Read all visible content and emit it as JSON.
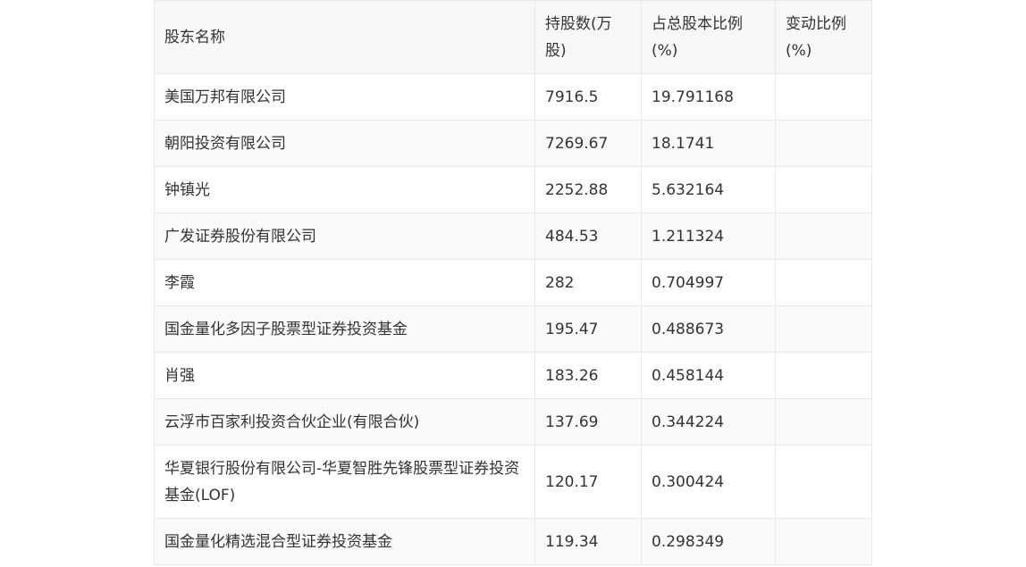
{
  "table": {
    "headers": [
      "股东名称",
      "持股数(万股)",
      "占总股本比例(%)",
      "变动比例(%)"
    ],
    "rows": [
      [
        "美国万邦有限公司",
        "7916.5",
        "19.791168",
        ""
      ],
      [
        "朝阳投资有限公司",
        "7269.67",
        "18.1741",
        ""
      ],
      [
        "钟镇光",
        "2252.88",
        "5.632164",
        ""
      ],
      [
        "广发证券股份有限公司",
        "484.53",
        "1.211324",
        ""
      ],
      [
        "李霞",
        "282",
        "0.704997",
        ""
      ],
      [
        "国金量化多因子股票型证券投资基金",
        "195.47",
        "0.488673",
        ""
      ],
      [
        "肖强",
        "183.26",
        "0.458144",
        ""
      ],
      [
        "云浮市百家利投资合伙企业(有限合伙)",
        "137.69",
        "0.344224",
        ""
      ],
      [
        "华夏银行股份有限公司-华夏智胜先锋股票型证券投资基金(LOF)",
        "120.17",
        "0.300424",
        ""
      ],
      [
        "国金量化精选混合型证券投资基金",
        "119.34",
        "0.298349",
        ""
      ]
    ]
  }
}
